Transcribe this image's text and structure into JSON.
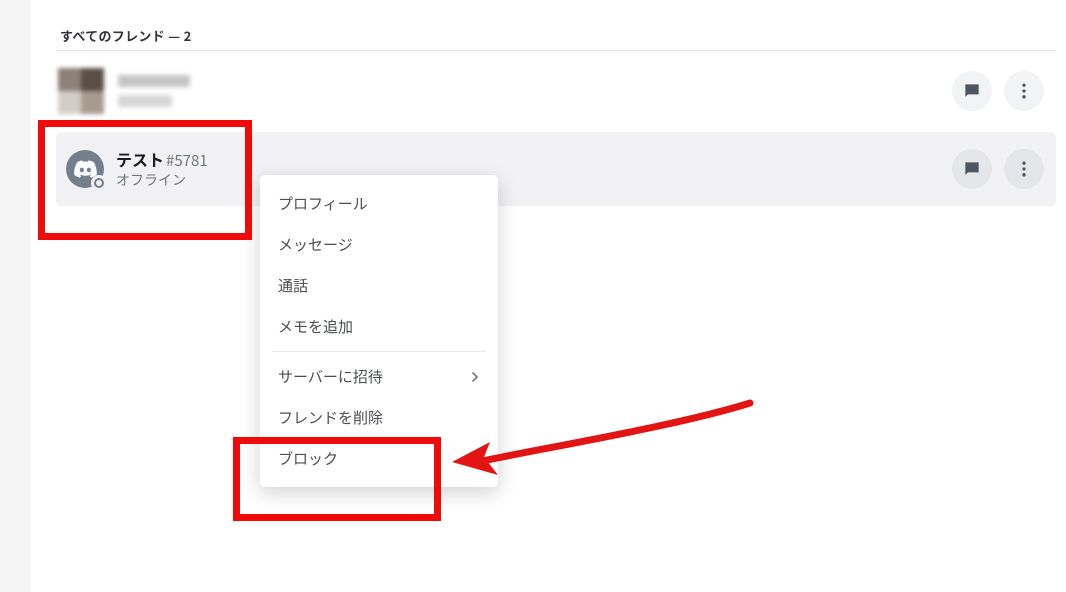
{
  "header": {
    "label": "すべてのフレンド",
    "separator": "—",
    "count": "2"
  },
  "friends": [
    {
      "name": "",
      "tag": "",
      "status": "",
      "blurred": true
    },
    {
      "name": "テスト",
      "tag": "#5781",
      "status": "オフライン",
      "avatar": "discord"
    }
  ],
  "actions": {
    "message": "メッセージ",
    "more": "その他"
  },
  "context_menu": {
    "items": [
      {
        "label": "プロフィール"
      },
      {
        "label": "メッセージ"
      },
      {
        "label": "通話"
      },
      {
        "label": "メモを追加"
      }
    ],
    "items2": [
      {
        "label": "サーバーに招待",
        "submenu": true
      },
      {
        "label": "フレンドを削除"
      },
      {
        "label": "ブロック"
      }
    ]
  },
  "annotations": {
    "highlight_friend": true,
    "highlight_block": true,
    "arrow_color": "#e21414"
  }
}
